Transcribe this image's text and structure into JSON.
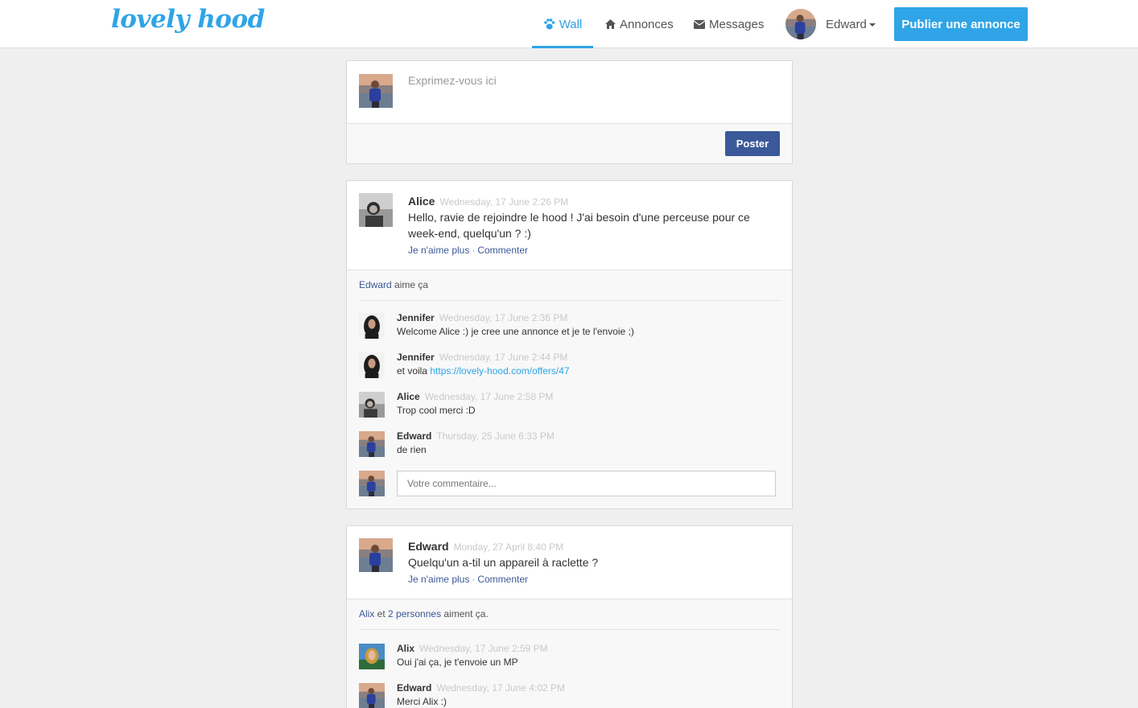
{
  "app": {
    "logo": "lovely hood"
  },
  "nav": {
    "wall": "Wall",
    "annonces": "Annonces",
    "messages": "Messages",
    "user": "Edward",
    "publish": "Publier une annonce"
  },
  "composer": {
    "placeholder": "Exprimez-vous ici",
    "post_button": "Poster"
  },
  "posts": [
    {
      "author": "Alice",
      "time": "Wednesday, 17 June 2:26 PM",
      "text": "Hello, ravie de rejoindre le hood ! J'ai besoin d'une perceuse pour ce week-end, quelqu'un ? :)",
      "actions": {
        "unlike": "Je n'aime plus",
        "sep": "·",
        "comment": "Commenter"
      },
      "likes": {
        "who": "Edward",
        "suffix": " aime ça"
      },
      "comments": [
        {
          "author": "Jennifer",
          "time": "Wednesday, 17 June 2:36 PM",
          "text": "Welcome Alice :) je cree une annonce et je te l'envoie ;)"
        },
        {
          "author": "Jennifer",
          "time": "Wednesday, 17 June 2:44 PM",
          "text": "et voila ",
          "link": "https://lovely-hood.com/offers/47"
        },
        {
          "author": "Alice",
          "time": "Wednesday, 17 June 2:58 PM",
          "text": "Trop cool merci :D"
        },
        {
          "author": "Edward",
          "time": "Thursday, 25 June 6:33 PM",
          "text": "de rien"
        }
      ],
      "comment_placeholder": "Votre commentaire..."
    },
    {
      "author": "Edward",
      "time": "Monday, 27 April 8:40 PM",
      "text": "Quelqu'un a-til un appareil à raclette ?",
      "actions": {
        "unlike": "Je n'aime plus",
        "sep": "·",
        "comment": "Commenter"
      },
      "likes": {
        "who": "Alix",
        "and": " et ",
        "others": "2 personnes",
        "suffix": " aiment ça."
      },
      "comments": [
        {
          "author": "Alix",
          "time": "Wednesday, 17 June 2:59 PM",
          "text": "Oui j'ai ça, je t'envoie un MP"
        },
        {
          "author": "Edward",
          "time": "Wednesday, 17 June 4:02 PM",
          "text": "Merci Alix :)"
        }
      ]
    }
  ],
  "icons": {
    "wall": "paw-icon",
    "annonces": "home-icon",
    "messages": "envelope-icon",
    "dropdown": "caret-down-icon"
  },
  "colors": {
    "brand": "#2fa4e7",
    "facebook_blue": "#3b5998",
    "background": "#efefef"
  }
}
